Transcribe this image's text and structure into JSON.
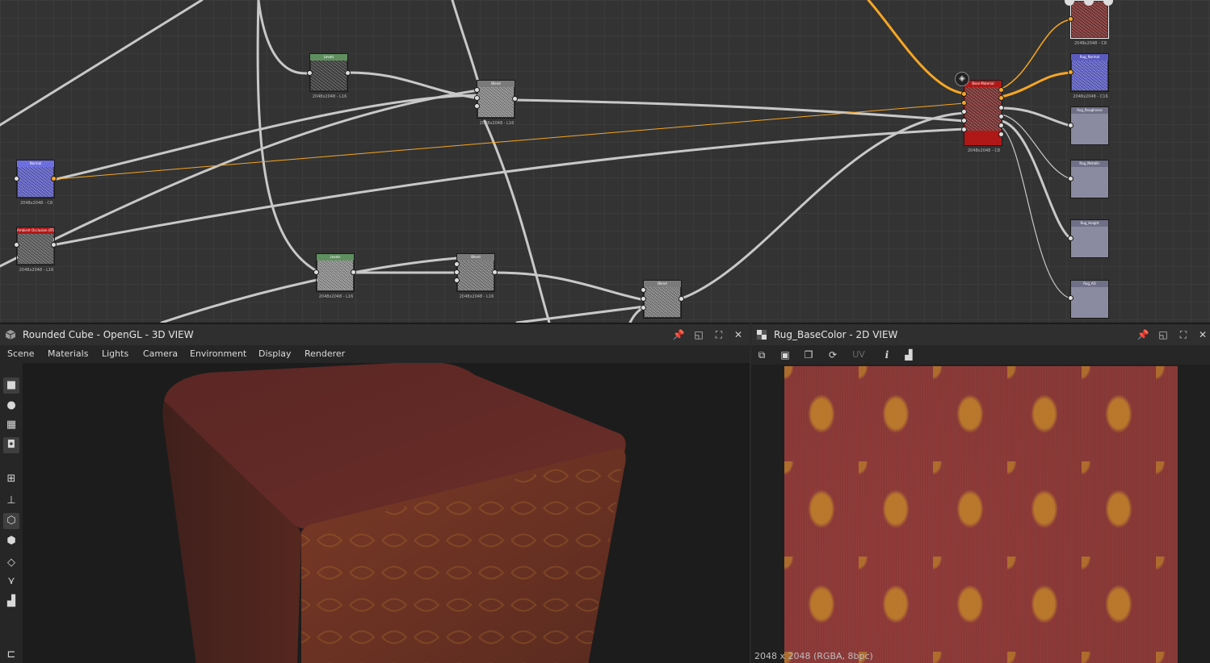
{
  "colors": {
    "accent_wire": "#f6a623",
    "wire": "#c8c8c8",
    "normal_thumb": "#6d6ee0",
    "base_material_header": "#b01818",
    "levels_header": "#5f8f5f",
    "texture_base": "#8a3a38",
    "texture_pattern": "#c88c28"
  },
  "graph": {
    "nodes": [
      {
        "id": "levels1",
        "title": "Levels",
        "caption": "2048x2048 - L16"
      },
      {
        "id": "blend1",
        "title": "Blend",
        "caption": "2048x2048 - L16"
      },
      {
        "id": "normal_in",
        "title": "Normal",
        "caption": "2048x2048 - C8"
      },
      {
        "id": "ao_in",
        "title": "Ambient Occlusion (RTAO)",
        "caption": "2048x2048 - L16"
      },
      {
        "id": "levels2",
        "title": "Levels",
        "caption": "2048x2048 - L16"
      },
      {
        "id": "blend2",
        "title": "Blend",
        "caption": "2048x2048 - L16"
      },
      {
        "id": "blend3",
        "title": "Blend",
        "caption": ""
      },
      {
        "id": "base_material",
        "title": "Base Material",
        "caption": "2048x2048 - C8"
      },
      {
        "id": "out_basecolor",
        "title": "",
        "caption": "2048x2048 - C8"
      },
      {
        "id": "out_normal",
        "title": "Rug_Normal",
        "caption": "2048x2048 - C16"
      },
      {
        "id": "out_roughness",
        "title": "Rug_Roughness",
        "caption": ""
      },
      {
        "id": "out_metallic",
        "title": "Rug_Metallic",
        "caption": ""
      },
      {
        "id": "out_height",
        "title": "Rug_Height",
        "caption": ""
      },
      {
        "id": "out_ao",
        "title": "Rug_AO",
        "caption": ""
      }
    ]
  },
  "view3d": {
    "title": "Rounded Cube - OpenGL - 3D VIEW",
    "icon": "cube-icon",
    "menu": [
      "Scene",
      "Materials",
      "Lights",
      "Camera",
      "Environment",
      "Display",
      "Renderer"
    ],
    "sidebar_icons": [
      "camera-icon",
      "light-bulb-icon",
      "environment-icon",
      "render-icon",
      "uv-grid-icon",
      "axis-icon",
      "cube-icon",
      "wireframe-cube-icon",
      "layers-icon",
      "tangent-icon",
      "histogram-icon",
      "hierarchy-icon"
    ],
    "window_buttons": [
      "pin-icon",
      "float-icon",
      "maximize-icon",
      "close-icon"
    ]
  },
  "view2d": {
    "title": "Rug_BaseColor - 2D VIEW",
    "icon": "checker-icon",
    "toolbar_icons": [
      "fit-view-icon",
      "save-icon",
      "copy-icon",
      "refresh-icon",
      "info-icon",
      "histogram-icon"
    ],
    "uv_label": "UV",
    "info_label": "i",
    "status": "2048 x 2048 (RGBA, 8bpc)",
    "window_buttons": [
      "pin-icon",
      "float-icon",
      "maximize-icon",
      "close-icon"
    ]
  }
}
